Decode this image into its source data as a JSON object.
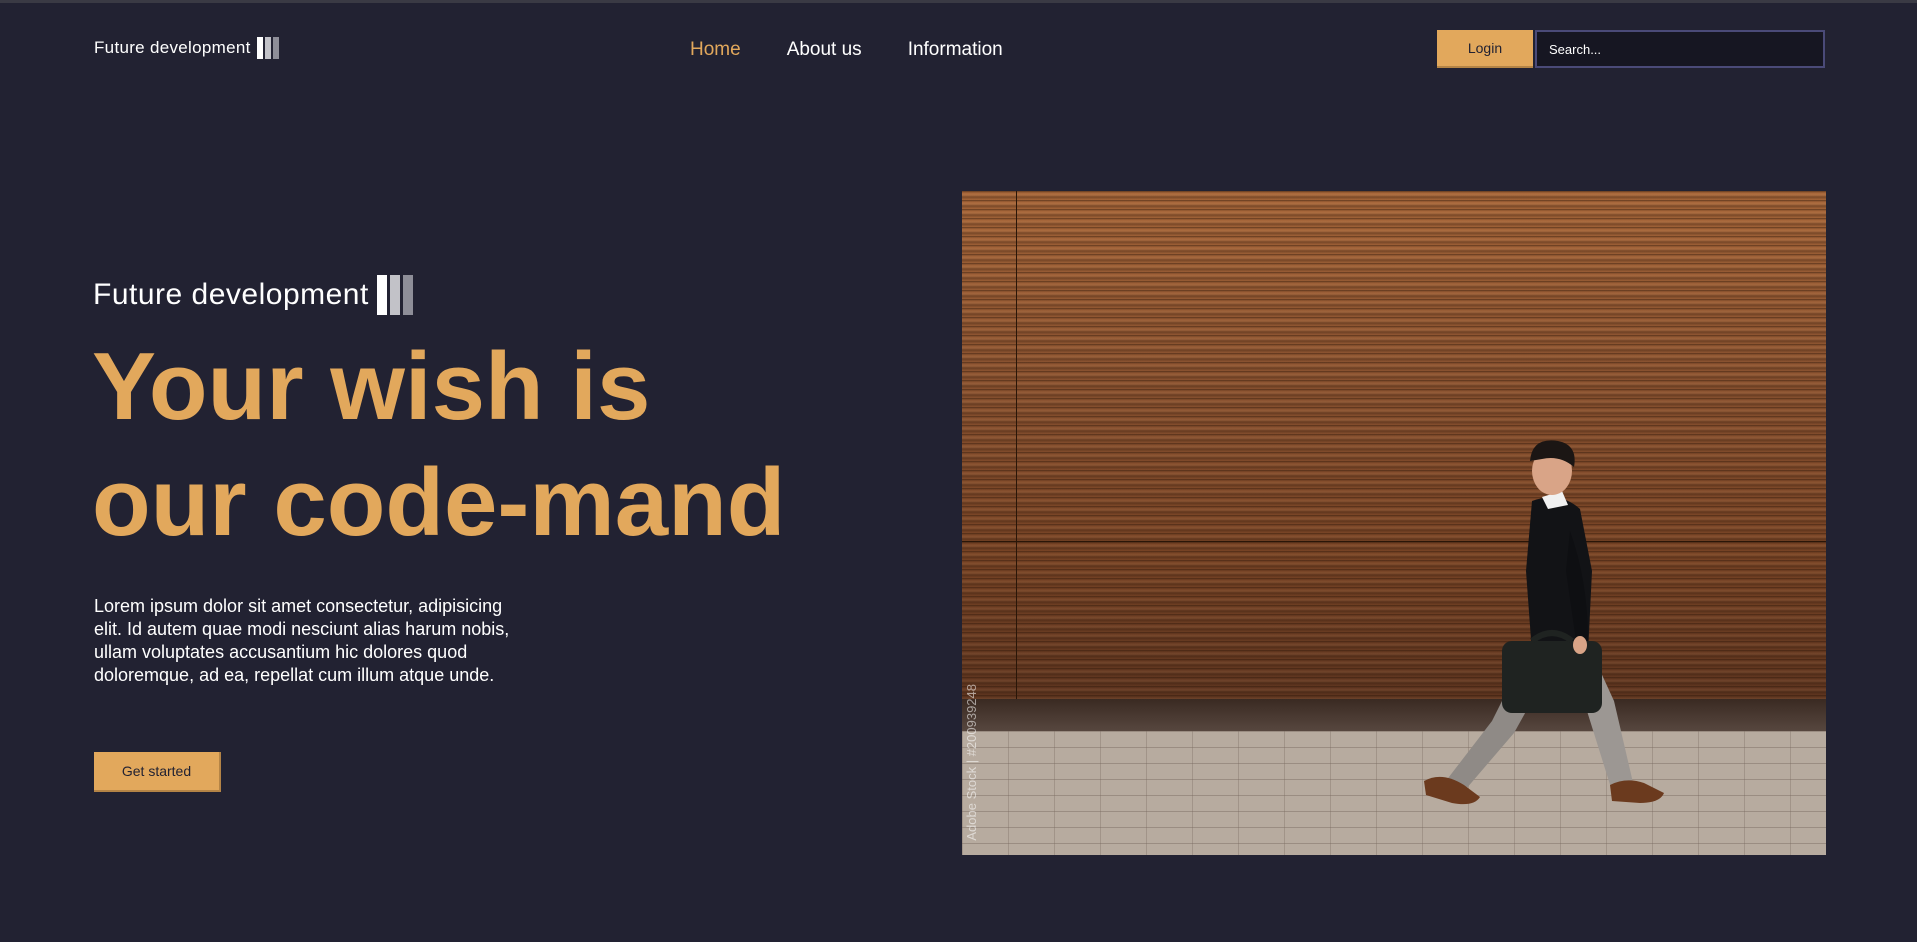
{
  "header": {
    "logo_text": "Future development",
    "nav": [
      {
        "label": "Home",
        "active": true
      },
      {
        "label": "About us",
        "active": false
      },
      {
        "label": "Information",
        "active": false
      }
    ],
    "login_label": "Login",
    "search_placeholder": "Search..."
  },
  "hero": {
    "brand_text": "Future development",
    "headline_line1": "Your wish is",
    "headline_line2": "our code-mand",
    "lead": "Lorem ipsum dolor sit amet consectetur, adipisicing elit. Id autem quae modi nesciunt alias harum nobis, ullam voluptates accusantium hic dolores quod doloremque, ad ea, repellat cum illum atque unde.",
    "cta_label": "Get started",
    "image": {
      "subject": "man walking past wooden wall with briefcase",
      "watermark": "Adobe Stock | #200939248"
    }
  },
  "colors": {
    "background": "#222232",
    "accent": "#e2a85c",
    "text": "#ffffff"
  }
}
